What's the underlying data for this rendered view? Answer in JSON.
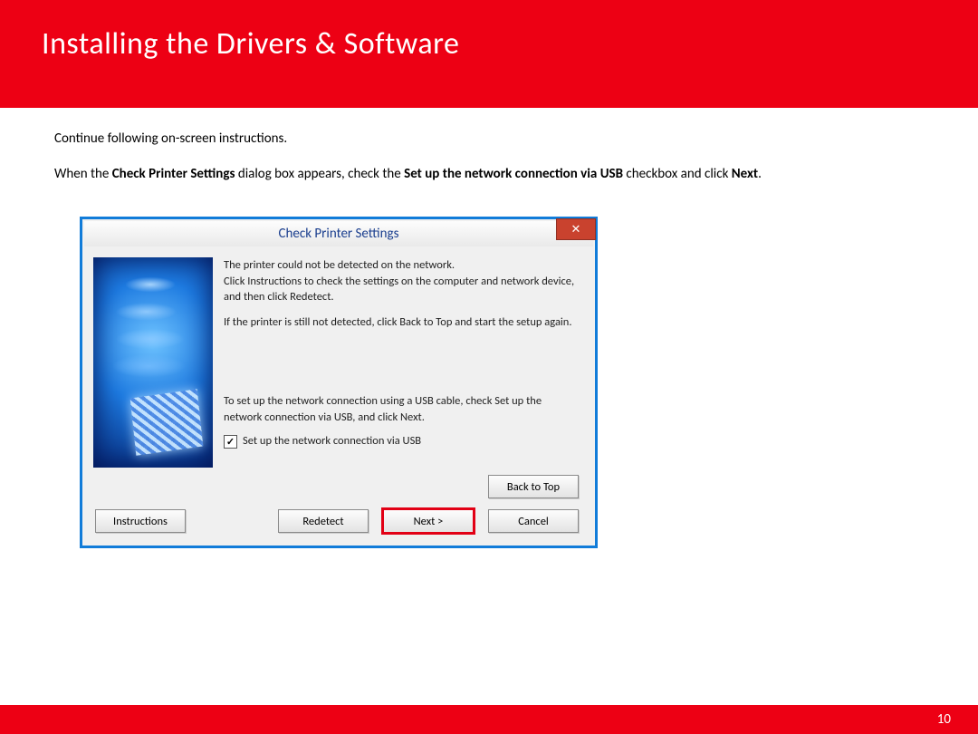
{
  "header": {
    "title": "Installing  the Drivers & Software"
  },
  "intro": {
    "line1": "Continue following on-screen instructions.",
    "line2_pre": "When the  ",
    "line2_bold1": "Check Printer Settings",
    "line2_mid1": " dialog box appears, check the ",
    "line2_bold2": "Set up the network connection via USB",
    "line2_mid2": " checkbox and click ",
    "line2_bold3": "Next",
    "line2_post": "."
  },
  "dialog": {
    "title": "Check Printer Settings",
    "close_symbol": "✕",
    "paragraph1": "The printer could not be detected on the network.\nClick Instructions to check the settings on the computer and network device, and then click Redetect.",
    "paragraph2": "If the printer is still not detected, click Back to Top and start the setup again.",
    "paragraph3": "To set up the network connection using a USB cable, check Set up the network connection via USB, and click Next.",
    "checkbox_label": "Set up the network connection via USB",
    "buttons": {
      "back_to_top": "Back to Top",
      "instructions": "Instructions",
      "redetect": "Redetect",
      "next": "Next >",
      "cancel": "Cancel"
    }
  },
  "page_number": "10"
}
